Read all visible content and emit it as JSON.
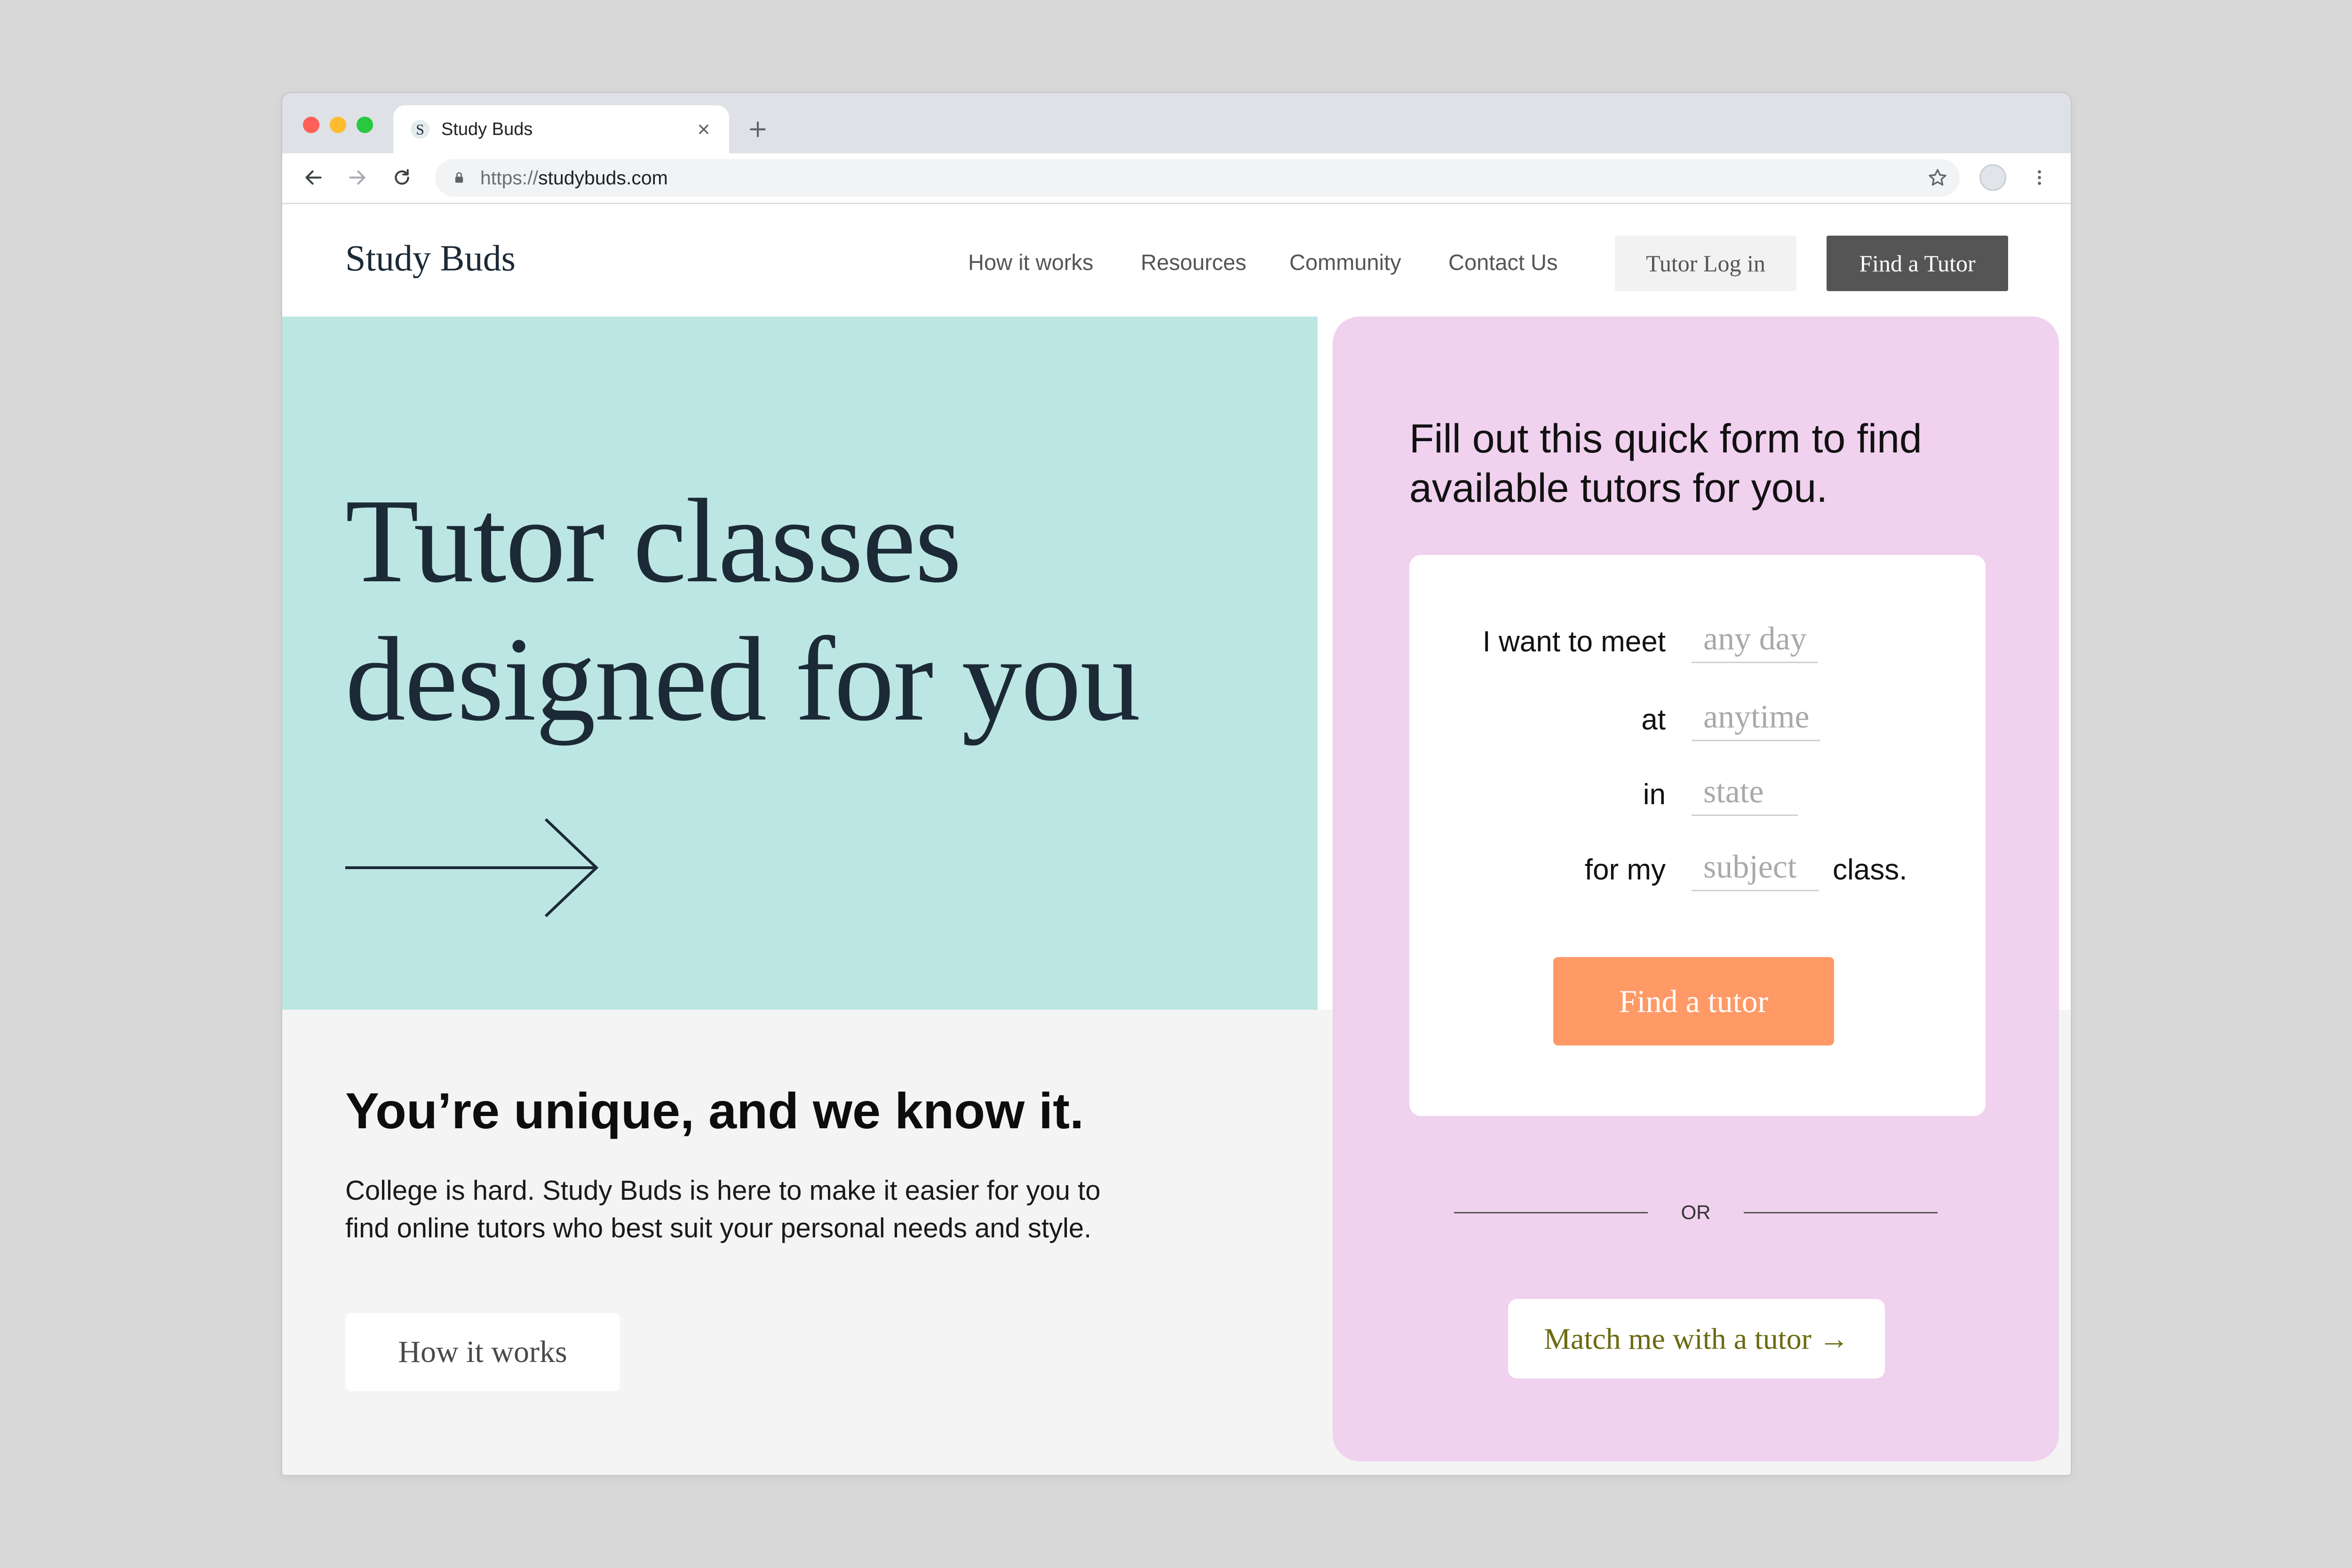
{
  "browser": {
    "favicon_letter": "S",
    "tab_title": "Study Buds",
    "url_scheme": "https://",
    "url_host": "studybuds.com"
  },
  "site": {
    "logo": "Study Buds",
    "nav": [
      "How it works",
      "Resources",
      "Community",
      "Contact Us"
    ],
    "login_button": "Tutor Log in",
    "cta_button": "Find a Tutor"
  },
  "hero": {
    "heading": [
      "Tutor classes",
      "designed for you"
    ]
  },
  "intro": {
    "heading": "You’re unique, and we know it.",
    "body": "College is hard. Study Buds is here to make it easier for you to find online tutors who best suit your personal needs and style.",
    "button": "How it works"
  },
  "form": {
    "title": "Fill out this quick form to find available tutors for you.",
    "rows": [
      {
        "label": "I want to meet",
        "placeholder": "any day"
      },
      {
        "label": "at",
        "placeholder": "anytime"
      },
      {
        "label": "in",
        "placeholder": "state"
      },
      {
        "label": "for my",
        "placeholder": "subject",
        "suffix": "class."
      }
    ],
    "submit": "Find a tutor",
    "divider": "OR",
    "match_button": "Match me with a tutor →"
  },
  "colors": {
    "page_bg": "#d8d8d8",
    "hero_bg": "#bce6e3",
    "section_bg": "#f4f4f4",
    "form_panel_bg": "#f0d1ee",
    "primary_button": "#ff9966",
    "accent_text": "#6b6a10",
    "dark_button": "#555555"
  },
  "icons": {
    "window_close": "close-window-dot",
    "window_minimize": "minimize-window-dot",
    "window_maximize": "maximize-window-dot",
    "tab_close": "close-icon",
    "new_tab": "plus-icon",
    "back": "arrow-left-icon",
    "forward": "arrow-right-icon",
    "reload": "reload-icon",
    "secure": "lock-icon",
    "bookmark": "star-icon",
    "profile": "avatar-icon",
    "menu": "more-vertical-icon",
    "hero_arrow": "long-arrow-right-icon"
  }
}
